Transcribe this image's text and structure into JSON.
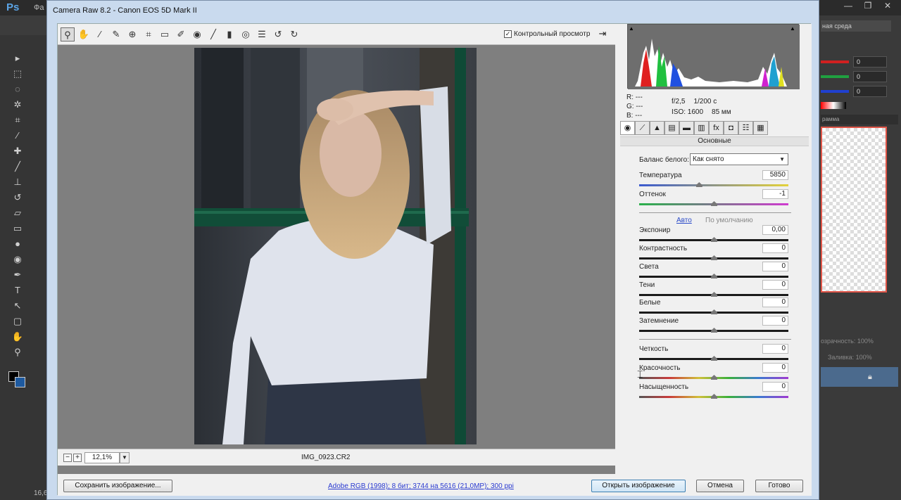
{
  "photoshop": {
    "logo": "Ps",
    "menu_fragment": "Фа",
    "window_buttons": [
      "—",
      "❐",
      "✕"
    ],
    "workspace": "ная среда",
    "color_values": [
      "0",
      "0",
      "0"
    ],
    "nav_title": "рамма",
    "layers_opacity": "озрачность:  100%",
    "layers_fill": "Заливка:  100%",
    "status_left": "16,6"
  },
  "dialog": {
    "title": "Camera Raw 8.2  -  Canon EOS 5D Mark II",
    "preview_label": "Контрольный просмотр",
    "preview_checked": "✓",
    "zoom": "12,1%",
    "filename": "IMG_0923.CR2",
    "workflow": "Adobe RGB (1998); 8 бит; 3744 на 5616 (21,0MP); 300 ppi",
    "buttons": {
      "save": "Сохранить изображение...",
      "open": "Открыть изображение",
      "cancel": "Отмена",
      "done": "Готово"
    }
  },
  "histogram_info": {
    "r": "R:   ---",
    "g": "G:   ---",
    "b": "B:   ---",
    "aperture": "f/2,5",
    "shutter": "1/200 с",
    "iso": "ISO: 1600",
    "focal": "85 мм"
  },
  "panel": {
    "section_title": "Основные",
    "wb_label": "Баланс белого:",
    "wb_value": "Как снято",
    "auto": "Авто",
    "default": "По умолчанию",
    "sliders": [
      {
        "label": "Температура",
        "value": "5850",
        "pos": 0.4
      },
      {
        "label": "Оттенок",
        "value": "-1",
        "pos": 0.5
      },
      {
        "label": "Экспонир",
        "value": "0,00",
        "pos": 0.5
      },
      {
        "label": "Контрастность",
        "value": "0",
        "pos": 0.5
      },
      {
        "label": "Света",
        "value": "0",
        "pos": 0.5
      },
      {
        "label": "Тени",
        "value": "0",
        "pos": 0.5
      },
      {
        "label": "Белые",
        "value": "0",
        "pos": 0.5
      },
      {
        "label": "Затемнение",
        "value": "0",
        "pos": 0.5
      },
      {
        "label": "Четкость",
        "value": "0",
        "pos": 0.5
      },
      {
        "label": "Красочность",
        "value": "0",
        "pos": 0.5
      },
      {
        "label": "Насыщенность",
        "value": "0",
        "pos": 0.5
      }
    ]
  }
}
